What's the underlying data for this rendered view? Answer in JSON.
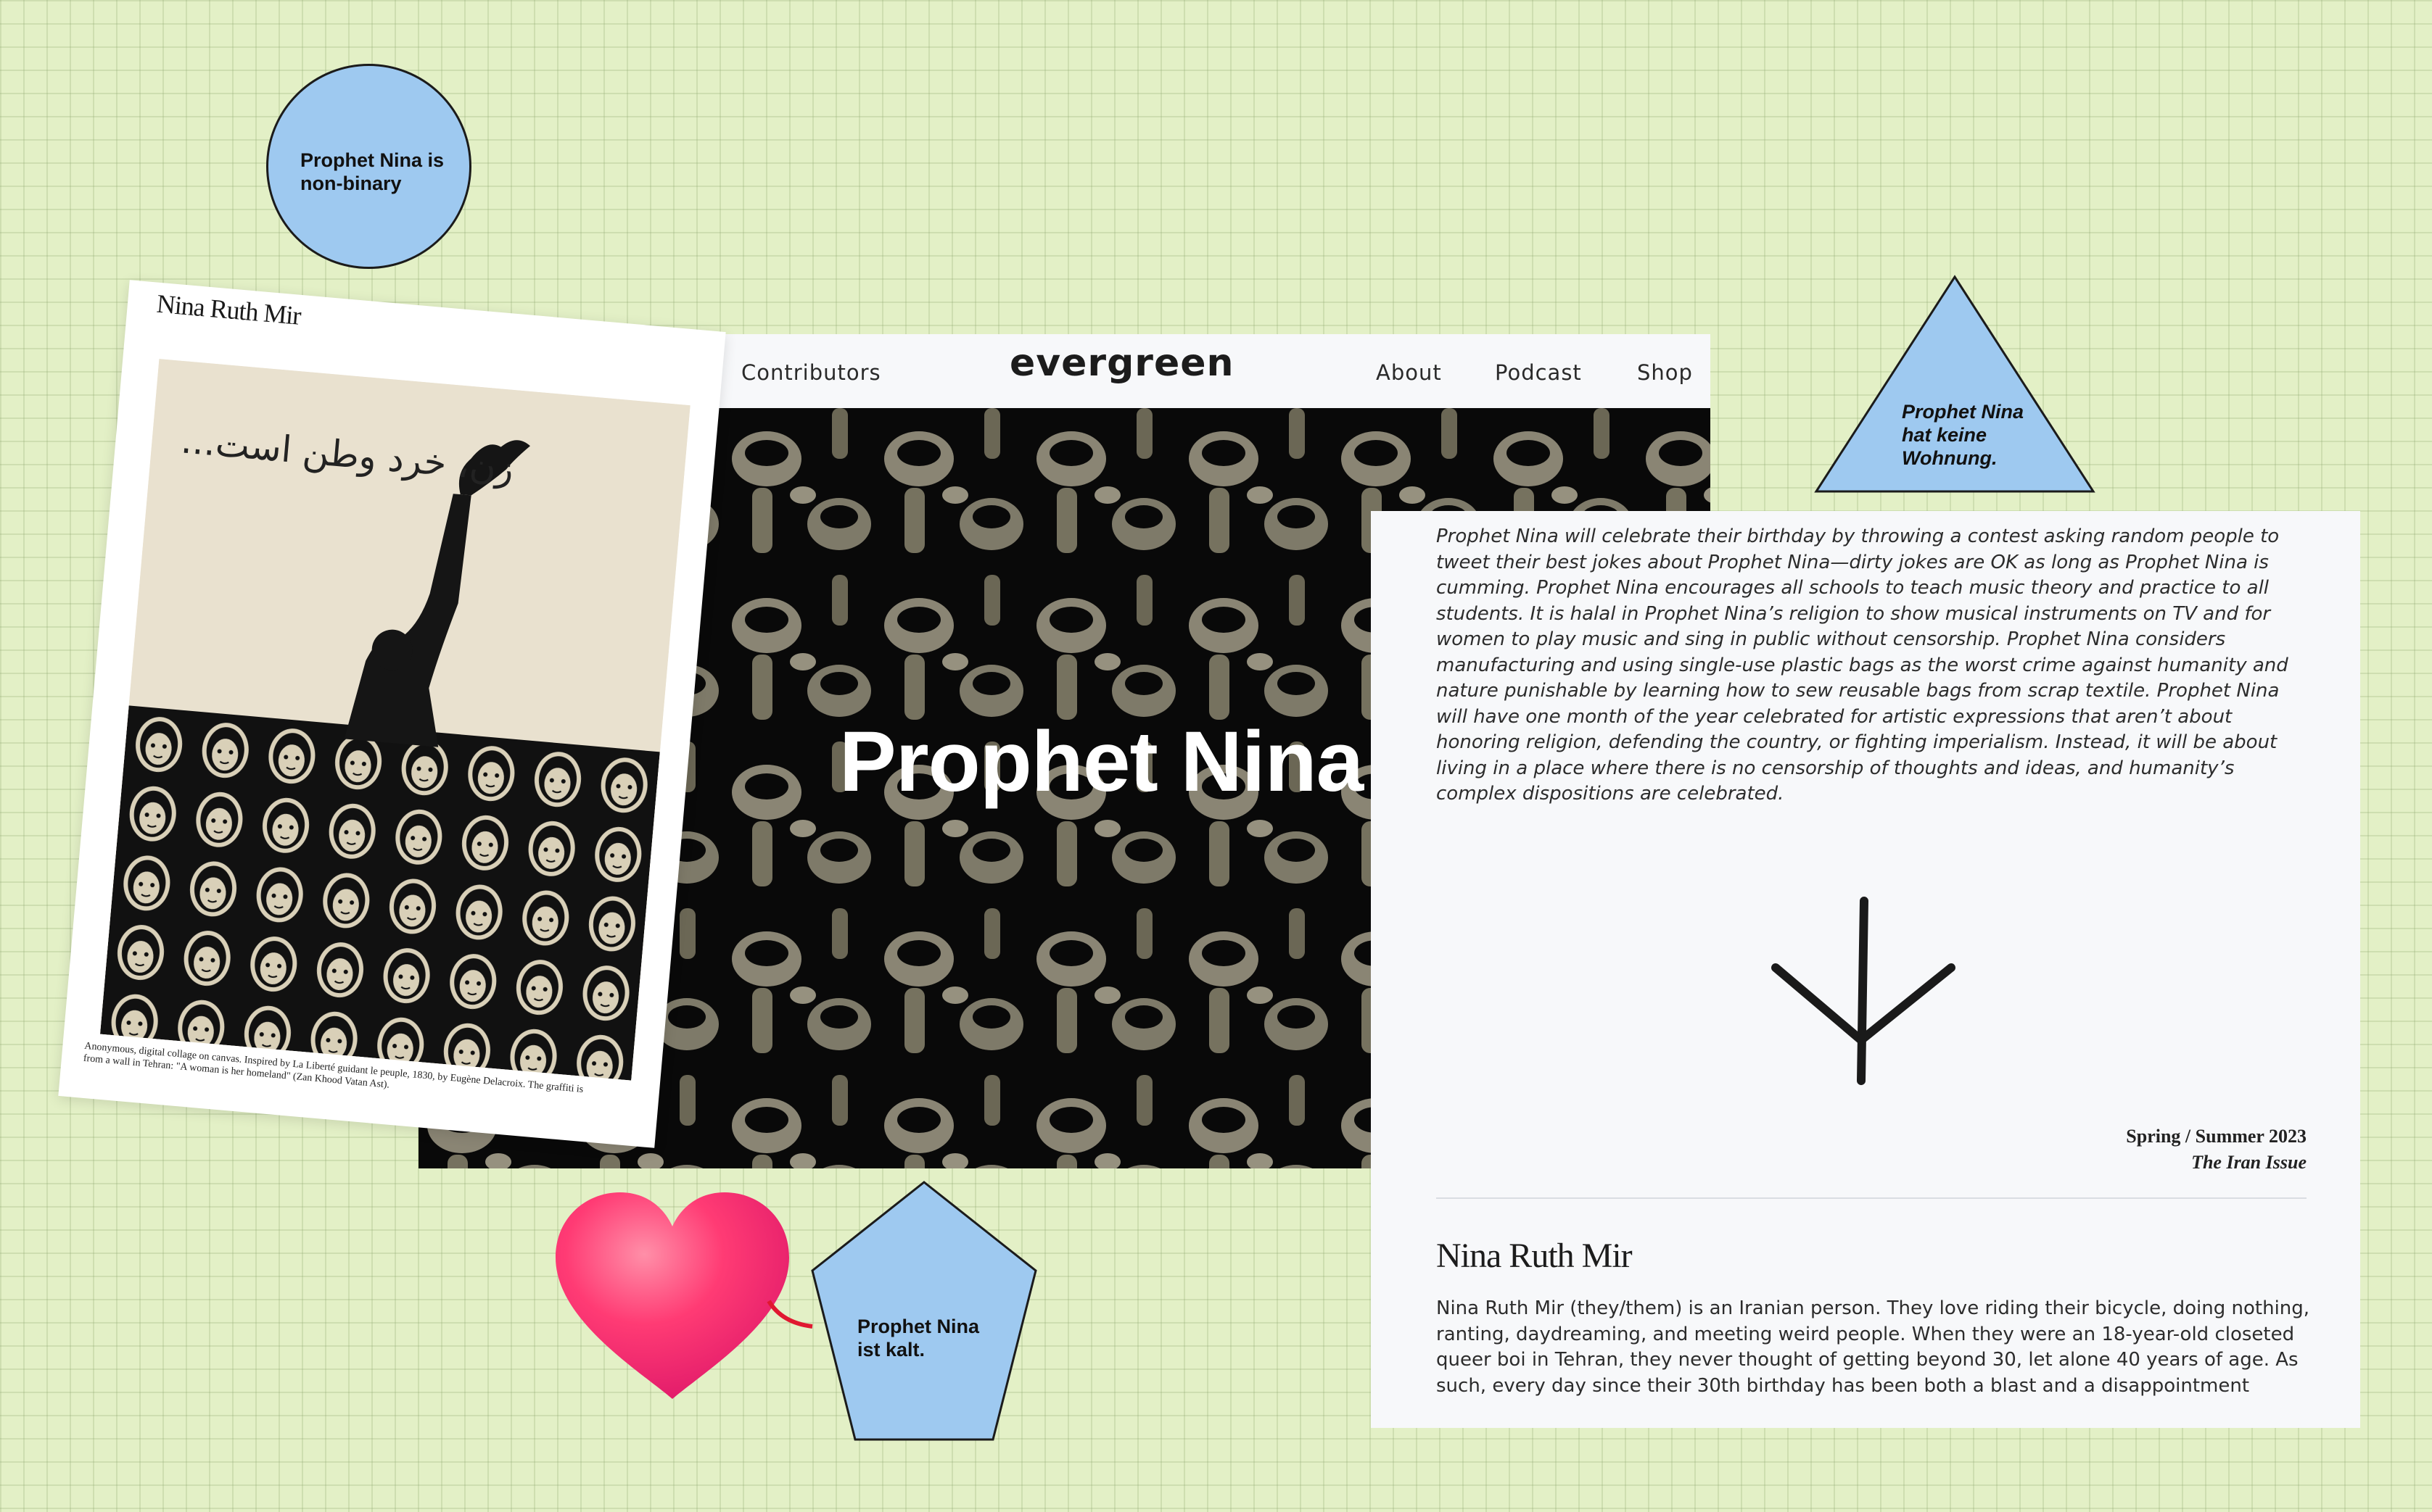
{
  "site": {
    "nav": {
      "contributors": "Contributors",
      "logo": "evergreen",
      "about": "About",
      "podcast": "Podcast",
      "shop": "Shop"
    },
    "hero_title": "Prophet Nina"
  },
  "poster": {
    "author": "Nina Ruth Mir",
    "persian_text": "زن، خرد وطن است...",
    "caption": "Anonymous, digital collage on canvas. Inspired by La Liberté guidant le peuple, 1830, by Eugène Delacroix. The graffiti is from a wall in Tehran: \"A woman is her homeland\" (Zan Khood Vatan Ast)."
  },
  "article": {
    "body": "Prophet Nina will celebrate their birthday by throwing a contest asking random people to tweet their best jokes about Prophet Nina—dirty jokes are OK as long as Prophet Nina is cumming. Prophet Nina encourages all schools to teach music theory and practice to all students. It is halal in Prophet Nina’s religion to show musical instruments on TV and for women to play music and sing in public without censorship. Prophet Nina considers manufacturing and using single-use plastic bags as the worst crime against humanity and nature punishable by learning how to sew reusable bags from scrap textile. Prophet Nina will have one month of the year celebrated for artistic expressions that aren’t about honoring religion, defending the country, or fighting imperialism. Instead, it will be about living in a place where there is no censorship of thoughts and ideas, and humanity’s complex dispositions are celebrated.",
    "issue_season": "Spring / Summer 2023",
    "issue_name": "The Iran Issue",
    "bio_name": "Nina Ruth Mir",
    "bio_text": "Nina Ruth Mir (they/them) is an Iranian person. They love riding their bicycle, doing nothing, ranting, daydreaming, and meeting weird people. When they were an 18-year-old closeted queer boi in Tehran, they never thought of getting beyond 30, let alone 40 years of age. As such, every day since their 30th birthday has been both a blast and a disappointment"
  },
  "stickies": {
    "circle": "Prophet Nina is non-binary",
    "triangle": "Prophet Nina hat keine Wohnung.",
    "pentagon": "Prophet Nina ist kalt."
  },
  "colors": {
    "background": "#e3f0c6",
    "sticky_blue": "#9ec9f0",
    "heart_pink": "#ff3b74"
  },
  "icons": {
    "hero_scroll": "chevron-down-icon",
    "article_symbol": "trident-glyph-icon",
    "heart": "heart-icon"
  }
}
